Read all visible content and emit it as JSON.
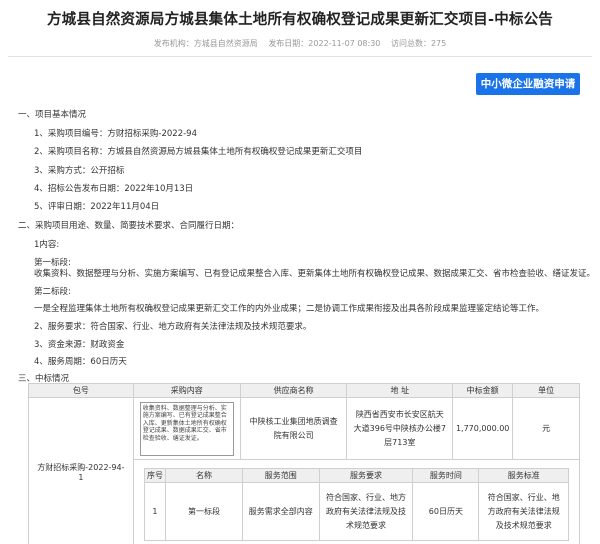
{
  "header": {
    "title": "方城县自然资源局方城县集体土地所有权确权登记成果更新汇交项目-中标公告",
    "publisher": "发布机构：方城县自然资源局",
    "publish_date": "发布日期：2022-11-07 08:30",
    "views": "访问总数：275"
  },
  "loan_button": "中小微企业融资申请",
  "section1": {
    "heading": "一、项目基本情况",
    "items": [
      "1、采购项目编号：方财招标采购-2022-94",
      "2、采购项目名称：方城县自然资源局方城县集体土地所有权确权登记成果更新汇交项目",
      "3、采购方式：公开招标",
      "4、招标公告发布日期：2022年10月13日",
      "5、评审日期：2022年11月04日"
    ]
  },
  "section2": {
    "heading": "二、采购项目用途、数量、简要技术要求、合同履行日期：",
    "content_label": "1内容:",
    "part1_label": "第一标段:",
    "part1_text": "收集资料、数据整理与分析、实施方案编写、已有登记成果整合入库、更新集体土地所有权确权登记成果、数据成果汇交、省市检查验收、缮证发证。",
    "part2_label": "第二标段:",
    "part2_text": "一是全程监理集体土地所有权确权登记成果更新汇交工作的内外业成果；二是协调工作成果衔接及出具各阶段成果监理鉴定结论等工作。",
    "service_req": "2、服务要求：符合国家、行业、地方政府有关法律法规及技术规范要求。",
    "funding": "3、资金来源：财政资金",
    "period": "4、服务周期：60日历天"
  },
  "section3": {
    "heading": "三、中标情况",
    "table_headers": [
      "包号",
      "采购内容",
      "供应商名称",
      "地 址",
      "中标金额",
      "单位"
    ],
    "row": {
      "package": "方财招标采购-2022-94-1",
      "content": "收集资料、数据整理与分析、实施方案编写、已有登记成果整合入库、更新集体土地所有权确权登记成果、数据成果汇交、省市检查验收、缮证发证。",
      "supplier": "中陕核工业集团地质调查院有限公司",
      "address": "陕西省西安市长安区航天大道396号中陕核办公楼7层713室",
      "amount": "1,770,000.00",
      "unit": "元"
    },
    "sub_headers": [
      "序号",
      "名称",
      "服务范围",
      "服务要求",
      "服务时间",
      "服务标准"
    ],
    "sub_row": {
      "no": "1",
      "name": "第一标段",
      "scope": "服务需求全部内容",
      "requirement": "符合国家、行业、地方政府有关法律法规及技术规范要求",
      "time": "60日历天",
      "standard": "符合国家、行业、地方政府有关法律法规及技术规范要求"
    }
  }
}
